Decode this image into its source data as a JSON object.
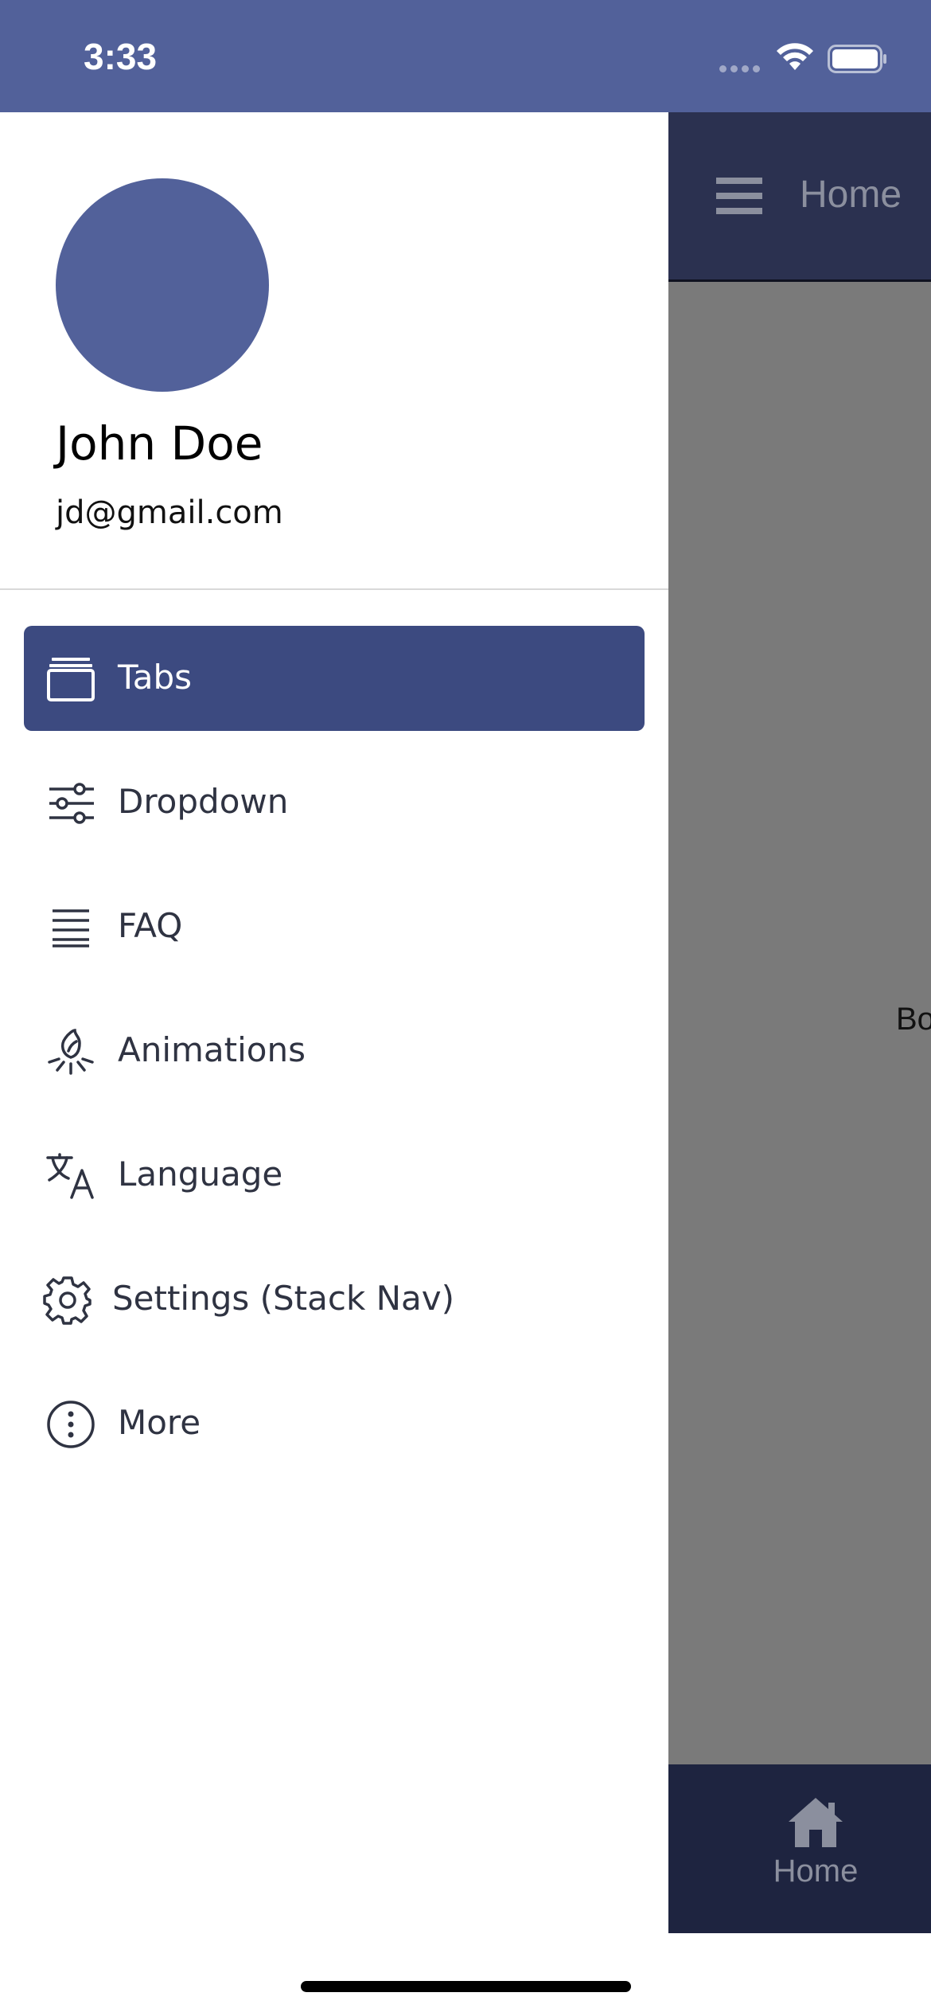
{
  "status_bar": {
    "time": "3:33",
    "background_color": "#52619a",
    "icons": [
      "signal-icon",
      "wifi-icon",
      "battery-icon"
    ]
  },
  "drawer": {
    "user": {
      "name": "John Doe",
      "email": "jd@gmail.com",
      "avatar_color": "#52619a"
    },
    "items": [
      {
        "label": "Tabs",
        "icon": "tabs-icon",
        "active": true
      },
      {
        "label": "Dropdown",
        "icon": "sliders-icon",
        "active": false
      },
      {
        "label": "FAQ",
        "icon": "list-icon",
        "active": false
      },
      {
        "label": "Animations",
        "icon": "animation-icon",
        "active": false
      },
      {
        "label": "Language",
        "icon": "translate-icon",
        "active": false
      },
      {
        "label": "Settings (Stack Nav)",
        "icon": "gear-icon",
        "active": false
      },
      {
        "label": "More",
        "icon": "more-vertical-icon",
        "active": false
      }
    ],
    "active_color": "#3c4a80"
  },
  "background_app": {
    "header_title": "Home",
    "body_text": "Bo",
    "tab_home_label": "Home",
    "header_color": "#2b3150",
    "tabbar_color": "#1e2440"
  }
}
